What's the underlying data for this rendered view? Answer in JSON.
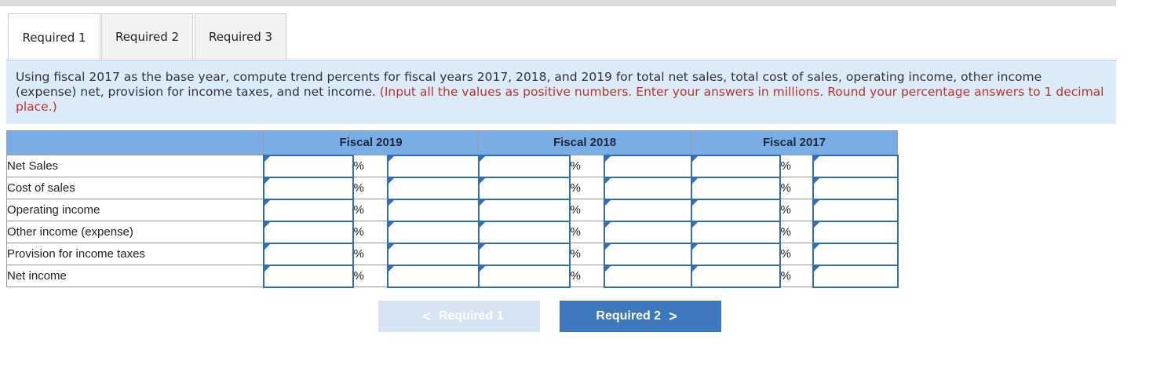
{
  "tabs": [
    {
      "label": "Required 1",
      "active": true
    },
    {
      "label": "Required 2",
      "active": false
    },
    {
      "label": "Required 3",
      "active": false
    }
  ],
  "instructions": {
    "text": "Using fiscal 2017 as the base year, compute trend percents for fiscal years 2017, 2018, and 2019 for total net sales, total cost of sales, operating income, other income (expense) net, provision for income taxes, and net income.",
    "note": "(Input all the values as positive numbers. Enter your answers in millions. Round your percentage answers to 1 decimal place.)"
  },
  "table": {
    "columns": [
      "Fiscal 2019",
      "Fiscal 2018",
      "Fiscal 2017"
    ],
    "percent_symbol": "%",
    "rows": [
      "Net Sales",
      "Cost of sales",
      "Operating income",
      "Other income (expense)",
      "Provision for income taxes",
      "Net income"
    ]
  },
  "nav": {
    "prev_label": "Required 1",
    "next_label": "Required 2",
    "prev_chevron": "<",
    "next_chevron": ">"
  },
  "colors": {
    "header_bg": "#7aade6",
    "input_border": "#2f6fb8",
    "instructions_bg": "#dcebf8",
    "note_red": "#c0312a",
    "next_button": "#3d78bd",
    "prev_button": "#d6e4f3"
  }
}
